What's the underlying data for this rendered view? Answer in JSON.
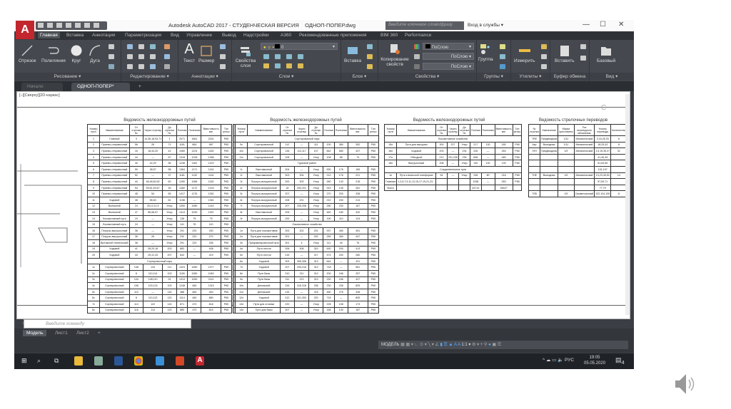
{
  "window": {
    "title": "Autodesk AutoCAD 2017 - СТУДЕНЧЕСКАЯ ВЕРСИЯ    ОДНОП-ПОПЕР.dwg",
    "app_button": "A",
    "search_placeholder": "Введите ключевое слово/фразу",
    "login": "Вход в службы ▾",
    "minimize": "—",
    "maximize": "☐",
    "close": "✕"
  },
  "ribbon_tabs": [
    "Главная",
    "Вставка",
    "Аннотации",
    "Параметризация",
    "Вид",
    "Управление",
    "Вывод",
    "Надстройки",
    "А360",
    "Рекомендованные приложения",
    "BIM 360",
    "Performance"
  ],
  "panels": {
    "draw": "Рисование ▾",
    "modify": "Редактирование ▾",
    "annotation": "Аннотации ▾",
    "layers": "Слои ▾",
    "block": "Блок ▾",
    "properties": "Свойства ▾",
    "groups": "Группы ▾",
    "utilities": "Утилиты ▾",
    "clipboard": "Буфер обмена",
    "view": "Вид ▾"
  },
  "tools": {
    "line": "Отрезок",
    "polyline": "Полилиния",
    "circle": "Круг",
    "arc": "Дуга",
    "text": "Текст",
    "dimension": "Размер",
    "layer_props": "Свойства слоя",
    "layer_value": "0",
    "insert": "Вставка",
    "match_props": "Копирование свойств",
    "color": "ПоСлою",
    "linetype": "ПоСлою",
    "lineweight": "ПоСлою",
    "group": "Группа",
    "measure": "Измерить",
    "paste": "Вставить",
    "base": "Базовый"
  },
  "doc_tabs": [
    "Начало",
    "ОДНОП-ПОПЕР*"
  ],
  "viewport_label": "[−][Сверху][2D-каркас]",
  "tables": [
    {
      "title": "Ведомость железнодорожных путей",
      "header": [
        "Номер пути",
        "Наименование",
        "От стрелки №",
        "Через стрелку",
        "До стрелки №",
        "Полная",
        "Полезная",
        "Вместимость ваг.",
        "Тип рельс"
      ],
      "rows": [
        [
          "1",
          "Главный",
          "3",
          "14,36,18,93,71",
          "1",
          "2071",
          "1661",
          "2241",
          "Р65"
        ],
        [
          "2",
          "Приемо-отправочный",
          "56",
          "26",
          "71",
          "1181",
          "864",
          "987",
          "Р65"
        ],
        [
          "3",
          "Приемо-отправочный",
          "16",
          "18,44,20",
          "42",
          "1080",
          "1224",
          "1160",
          "Р65"
        ],
        [
          "4",
          "Приемо-отправочный",
          "44",
          "—",
          "67",
          "1318",
          "1228",
          "1266",
          "Р65"
        ],
        [
          "5",
          "Приемо-отправочный",
          "40",
          "42,29",
          "56",
          "1246",
          "1162",
          "1222",
          "Р65"
        ],
        [
          "6",
          "Приемо-отправочный",
          "50",
          "38,57",
          "58",
          "1364",
          "1171",
          "1241",
          "Р65"
        ],
        [
          "7",
          "Приемо-отправочный",
          "52",
          "—",
          "37",
          "1181",
          "1132",
          "1116",
          "Р65"
        ],
        [
          "8",
          "Приемо-отправочный",
          "44",
          "46,48,50,52",
          "60",
          "1260",
          "1066",
          "1182",
          "Р65"
        ],
        [
          "9",
          "Приемо-отправочный",
          "54",
          "59,61,63,67",
          "45",
          "1460",
          "1172",
          "1243",
          "Р65"
        ],
        [
          "10",
          "Приемо-отправочный",
          "48",
          "54",
          "65",
          "1417",
          "1176",
          "1261",
          "Р65"
        ],
        [
          "11",
          "Ходовой",
          "48",
          "56,63",
          "81",
          "1158",
          "—",
          "1361",
          "Р65"
        ],
        [
          "12",
          "Вытяжной",
          "24",
          "25,12,11,5",
          "Упор",
          "1050",
          "1080",
          "1144",
          "Р65"
        ],
        [
          "13",
          "Вытяжной",
          "47",
          "56,58,57",
          "Упор",
          "1313",
          "1030",
          "1357",
          "Р65"
        ],
        [
          "14",
          "Локомотивный путь",
          "19",
          "—",
          "Упор",
          "136",
          "75",
          "75",
          "Р65"
        ],
        [
          "15",
          "Локомотивный путь",
          "24",
          "—",
          "Упор",
          "141",
          "76",
          "110",
          "Р65"
        ],
        [
          "16",
          "Погрузо-выгрузочный",
          "36",
          "—",
          "Упор",
          "291",
          "220",
          "330",
          "Р65"
        ],
        [
          "17",
          "Погрузо-выгрузочный",
          "36",
          "26",
          "Упор",
          "232",
          "220",
          "270",
          "Р65"
        ],
        [
          "18",
          "Вытяжной технический",
          "38",
          "—",
          "Упор",
          "291",
          "220",
          "336",
          "Р65"
        ],
        [
          "19",
          "Ходовой",
          "41",
          "28,20,18",
          "203",
          "883",
          "—",
          "408",
          "Р65"
        ],
        [
          "20",
          "Ходовой",
          "43",
          "25,31,33",
          "207",
          "843",
          "—",
          "419",
          "Р65"
        ],
        [
          "§",
          "Сортировочный парк"
        ],
        [
          "1с",
          "Сортировочный",
          "108",
          "133",
          "111",
          "1424",
          "1080",
          "1377",
          "Р65"
        ],
        [
          "2с",
          "Сортировочный",
          "8",
          "110,114",
          "102",
          "1150",
          "1080",
          "1062",
          "Р65"
        ],
        [
          "3с",
          "Сортировочный",
          "104",
          "108,110",
          "91",
          "1313",
          "1050",
          "1110",
          "Р65"
        ],
        [
          "4с",
          "Сортировочный",
          "106",
          "103,124",
          "100",
          "1248",
          "460",
          "1319",
          "Р65"
        ],
        [
          "5с",
          "Сортировочный",
          "110",
          "—",
          "116",
          "488",
          "460",
          "463",
          "Р65"
        ],
        [
          "6с",
          "Сортировочный",
          "8",
          "110,113",
          "120",
          "1114",
          "460",
          "880",
          "Р65"
        ],
        [
          "7с",
          "Сортировочный",
          "114",
          "122",
          "124",
          "871",
          "470",
          "818",
          "Р65"
        ],
        [
          "8с",
          "Сортировочный",
          "116",
          "114",
          "120",
          "880",
          "470",
          "815",
          "Р65"
        ]
      ]
    },
    {
      "title": "Ведомость железнодорожных путей",
      "header": [
        "Номер пути",
        "Наименование",
        "От стрелки №",
        "Через стрелку",
        "До стрелки №",
        "Полная",
        "Полезная",
        "Вместимость ваг.",
        "Тип рельс"
      ],
      "rows": [
        [
          "§",
          "Сортировочный парк"
        ],
        [
          "9с",
          "Сортировочный",
          "112",
          "—",
          "111",
          "200",
          "380",
          "352",
          "Р65"
        ],
        [
          "10с",
          "Сортировочный",
          "136",
          "113,117",
          "107",
          "662",
          "580",
          "437",
          "Р65"
        ],
        [
          "11с",
          "Сортировочный",
          "108",
          "—",
          "Упор",
          "108",
          "85",
          "74",
          "Р65"
        ],
        [
          "§",
          "Грузовой район"
        ],
        [
          "1г",
          "Выставочный",
          "304",
          "—",
          "Упор",
          "530",
          "176",
          "169",
          "Р65"
        ],
        [
          "2г",
          "Выставочный",
          "303",
          "304",
          "Упор",
          "212",
          "176",
          "221",
          "Р65"
        ],
        [
          "3г",
          "Погрузо-выгрузочный",
          "200",
          "303",
          "Упор",
          "280",
          "143",
          "218",
          "Р65"
        ],
        [
          "4г",
          "Погрузо-выгрузочный",
          "18",
          "200,201",
          "Упор",
          "919",
          "145",
          "281",
          "Р65"
        ],
        [
          "5г",
          "Погрузо-выгрузочный",
          "207",
          "—",
          "Упор",
          "270",
          "200",
          "338",
          "Р65"
        ],
        [
          "6г",
          "Погрузо-выгрузочный",
          "208",
          "201",
          "Упор",
          "210",
          "200",
          "214",
          "Р65"
        ],
        [
          "7г",
          "Погрузо-выгрузочный",
          "207",
          "205,208",
          "Упор",
          "280",
          "230",
          "187",
          "Р65"
        ],
        [
          "8г",
          "Выставочный",
          "205",
          "—",
          "Упор",
          "482",
          "180",
          "432",
          "Р65"
        ],
        [
          "9г",
          "Погрузо-выгрузочный",
          "200",
          "—",
          "Упор",
          "190",
          "110",
          "124",
          "Р65"
        ],
        [
          "§",
          "Локомотивное хозяйство"
        ],
        [
          "1л",
          "Пути для локомотивов",
          "303",
          "302",
          "201",
          "937",
          "450",
          "451",
          "Р65"
        ],
        [
          "2л",
          "Пути для локомотивов",
          "301",
          "—",
          "202",
          "289",
          "450",
          "447",
          "Р65"
        ],
        [
          "3л",
          "Предэкипировочный путь",
          "301",
          "4",
          "Упор",
          "111",
          "40",
          "76",
          "Р65"
        ],
        [
          "4л",
          "Пути отстоя",
          "206",
          "306",
          "310",
          "630",
          "200",
          "413",
          "Р65"
        ],
        [
          "5л",
          "Пути отстоя",
          "216",
          "—",
          "217",
          "474",
          "200",
          "280",
          "Р65"
        ],
        [
          "6л",
          "Ходовой",
          "303",
          "306,308",
          "313",
          "844",
          "—",
          "431",
          "Р65"
        ],
        [
          "7л",
          "Ходовой",
          "207",
          "205,216",
          "313",
          "718",
          "—",
          "581",
          "Р65"
        ],
        [
          "8л",
          "Пути базы",
          "310",
          "211",
          "312",
          "200",
          "156",
          "257",
          "Р65"
        ],
        [
          "9л",
          "Пути базы",
          "311",
          "213",
          "313",
          "230",
          "156",
          "427",
          "Р65"
        ],
        [
          "10л",
          "Деповской",
          "316",
          "316,318",
          "236",
          "230",
          "236",
          "825",
          "Р65"
        ],
        [
          "11л",
          "Деповской",
          "216",
          "—",
          "218",
          "480",
          "276",
          "438",
          "Р65"
        ],
        [
          "12л",
          "Ходовой",
          "312",
          "321,300",
          "220",
          "718",
          "—",
          "805",
          "Р65"
        ],
        [
          "13л",
          "Пути для стоянки",
          "220",
          "—",
          "Упор",
          "226",
          "108",
          "173",
          "Р65"
        ],
        [
          "14л",
          "Пути для базы",
          "307",
          "—",
          "Упор",
          "168",
          "130",
          "187",
          "Р65"
        ]
      ]
    },
    {
      "title": "Ведомость железнодорожных путей",
      "header": [
        "Номер пути",
        "Наименование",
        "От стрелки №",
        "Через стрелку",
        "До стрелки №",
        "Полная",
        "Полезная",
        "Вместимость ваг.",
        "Тип рельс"
      ],
      "rows": [
        [
          "§",
          "Локомотивное хозяйство"
        ],
        [
          "15л",
          "Пути для выгрузки",
          "300",
          "227",
          "Упор",
          "217",
          "130",
          "180",
          "Р65"
        ],
        [
          "16л",
          "Ходовой",
          "203",
          "—",
          "234",
          "226",
          "—",
          "263",
          "Р65"
        ],
        [
          "17л",
          "Обходной",
          "212",
          "201,235",
          "235",
          "658",
          "—",
          "460",
          "Р65"
        ],
        [
          "18л",
          "Выгрузочный",
          "208",
          "—",
          "Упор",
          "130",
          "130",
          "130",
          "Р65"
        ],
        [
          "§",
          "Соединительные пути"
        ],
        [
          "1п",
          "Пути к воинской платформе",
          "54",
          "—",
          "Упор",
          "248",
          "80",
          "218",
          "Р65"
        ],
        [
          "Главные",
          "1,3,5,7,9,11,13,15,17,19,21,23...",
          "",
          "",
          "",
          "1258",
          "—",
          "263",
          "Р65"
        ],
        [
          "Всего",
          "",
          "",
          "",
          "",
          "44714",
          "",
          "28427",
          ""
        ]
      ]
    },
    {
      "title": "Ведомость стрелочных переводов",
      "header": [
        "№ стрелки",
        "Назначение",
        "Марка крестовины",
        "Тип переводного механизма",
        "Номер перевода",
        "Количество"
      ],
      "rows": [
        [
          "7RЕ",
          "Предвходная",
          "1/11",
          "Механический",
          "2,16,25,33",
          "6"
        ],
        [
          "4ар",
          "Выходная",
          "1/11",
          "Механический",
          "18,25,43",
          "8"
        ],
        [
          "7ЛН",
          "Предвходная",
          "1/9",
          "Механический",
          "1,5,15,35,37",
          "31"
        ],
        [
          "",
          "",
          "",
          "",
          "41,45,49",
          ""
        ],
        [
          "",
          "",
          "",
          "",
          "61,63,65",
          ""
        ],
        [
          "",
          "",
          "",
          "",
          "101,107",
          ""
        ],
        [
          "7НЕ",
          "Выходная",
          "1/9",
          "Механический",
          "13,23,45,53",
          "14"
        ],
        [
          "",
          "",
          "",
          "",
          "57,69,71",
          ""
        ],
        [
          "",
          "",
          "",
          "",
          "77,79",
          ""
        ],
        [
          "7ЛВ",
          "",
          "1/9",
          "Симметричный",
          "102,104,106",
          "8"
        ]
      ]
    }
  ],
  "command_placeholder": "Введите команду",
  "layout_tabs": [
    "Модель",
    "Лист1",
    "Лист2",
    "+"
  ],
  "status": {
    "model": "МОДЕЛЬ",
    "scale": "1:1 ▾"
  },
  "taskbar": {
    "lang": "РУС",
    "time": "19:05",
    "date": "05.05.2020",
    "notifications": "4"
  }
}
